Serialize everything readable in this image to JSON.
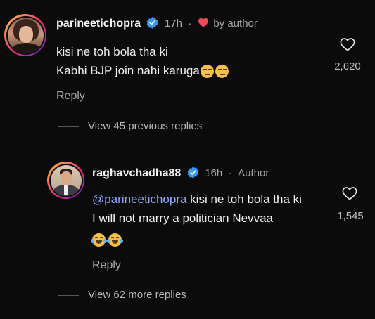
{
  "comment1": {
    "username": "parineetichopra",
    "time": "17h",
    "separator": "·",
    "liked_by": "by author",
    "text_line1": "kisi ne toh bola tha ki",
    "text_line2": "Kabhi BJP join nahi karuga",
    "likes": "2,620",
    "reply_label": "Reply"
  },
  "view_previous": "View 45 previous replies",
  "comment2": {
    "username": "raghavchadha88",
    "time": "16h",
    "separator": "·",
    "author_label": "Author",
    "mention": "@parineetichopra",
    "text_line1_rest": " kisi ne toh bola tha ki",
    "text_line2": "I will not marry a politician Nevvaa",
    "likes": "1,545",
    "reply_label": "Reply"
  },
  "view_more": "View 62 more replies",
  "colors": {
    "background": "#0b0b0c",
    "verified": "#3897f0",
    "heart": "#ed4956",
    "mention": "#8ea5ff",
    "muted": "#a8a8a8"
  }
}
